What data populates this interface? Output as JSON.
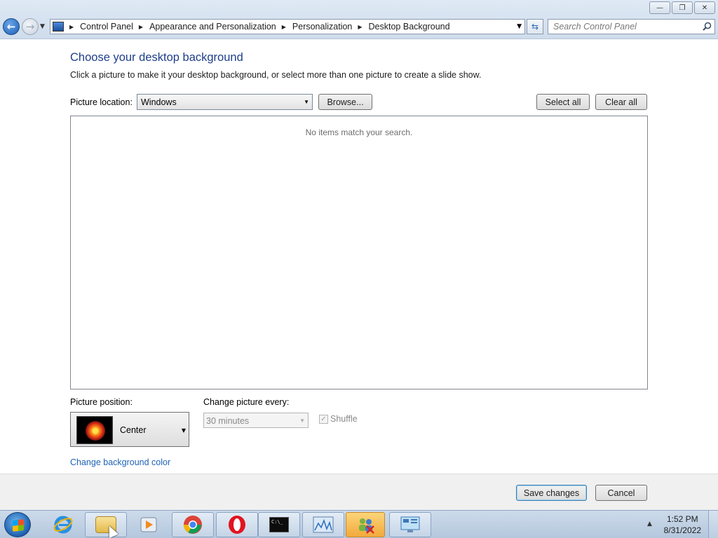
{
  "window": {
    "controls": {
      "minimize": "—",
      "maximize": "❐",
      "close": "✕"
    }
  },
  "nav": {
    "back_icon": "arrow-left-icon",
    "forward_icon": "arrow-right-icon",
    "breadcrumbs": [
      "Control Panel",
      "Appearance and Personalization",
      "Personalization",
      "Desktop Background"
    ],
    "search_placeholder": "Search Control Panel"
  },
  "main": {
    "heading": "Choose your desktop background",
    "subtext": "Click a picture to make it your desktop background, or select more than one picture to create a slide show.",
    "picture_location_label": "Picture location:",
    "picture_location_value": "Windows",
    "browse_label": "Browse...",
    "select_all_label": "Select all",
    "clear_all_label": "Clear all",
    "empty_message": "No items match your search.",
    "picture_position_label": "Picture position:",
    "picture_position_value": "Center",
    "change_every_label": "Change picture every:",
    "change_every_value": "30 minutes",
    "shuffle_label": "Shuffle",
    "shuffle_checked": true,
    "bg_color_link": "Change background color"
  },
  "footer": {
    "save_label": "Save changes",
    "cancel_label": "Cancel"
  },
  "taskbar": {
    "items": [
      "internet-explorer-icon",
      "windows-explorer-icon",
      "media-player-icon",
      "chrome-icon",
      "opera-icon",
      "command-prompt-icon",
      "resource-monitor-icon",
      "users-icon",
      "control-panel-icon"
    ],
    "cmd_text": "C:\\_",
    "time": "1:52 PM",
    "date": "8/31/2022"
  },
  "colors": {
    "heading": "#1e3e8a",
    "link": "#1e63b4",
    "accent": "#3a7bd5"
  }
}
